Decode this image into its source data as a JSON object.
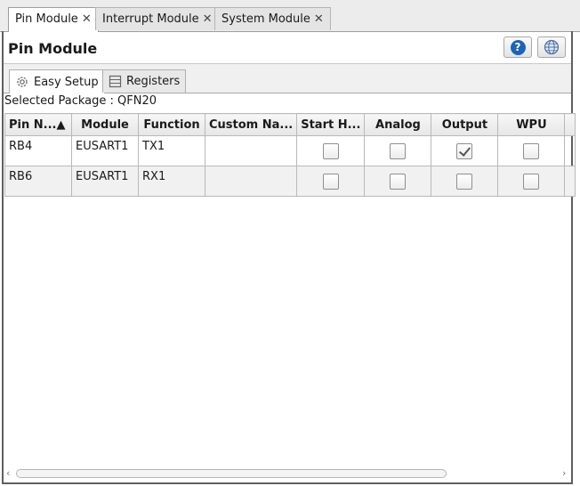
{
  "doc_tabs": [
    {
      "label": "Pin Module",
      "close": "✕",
      "active": true
    },
    {
      "label": "Interrupt Module",
      "close": "✕",
      "active": false
    },
    {
      "label": "System Module",
      "close": "✕",
      "active": false
    }
  ],
  "header": {
    "title": "Pin Module",
    "help_icon": "question-mark-icon",
    "help_glyph": "?",
    "globe_icon": "globe-icon"
  },
  "inner_tabs": [
    {
      "label": "Easy Setup",
      "icon": "gear-icon",
      "active": true
    },
    {
      "label": "Registers",
      "icon": "register-list-icon",
      "active": false
    }
  ],
  "package": {
    "text": "Selected Package : QFN20"
  },
  "table": {
    "columns": [
      "Pin N...▲",
      "Module",
      "Function",
      "Custom Na...",
      "Start H...",
      "Analog",
      "Output",
      "WPU"
    ],
    "rows": [
      {
        "pin": "RB4",
        "module": "EUSART1",
        "function": "TX1",
        "custom_name": "",
        "start_high": false,
        "analog": false,
        "output": true,
        "wpu": false
      },
      {
        "pin": "RB6",
        "module": "EUSART1",
        "function": "RX1",
        "custom_name": "",
        "start_high": false,
        "analog": false,
        "output": false,
        "wpu": false
      }
    ]
  },
  "scrollbar": {
    "left_arrow": "‹",
    "right_arrow": "›"
  },
  "colors": {
    "help_blue": "#1d63b8",
    "frame": "#5f5f5f"
  }
}
